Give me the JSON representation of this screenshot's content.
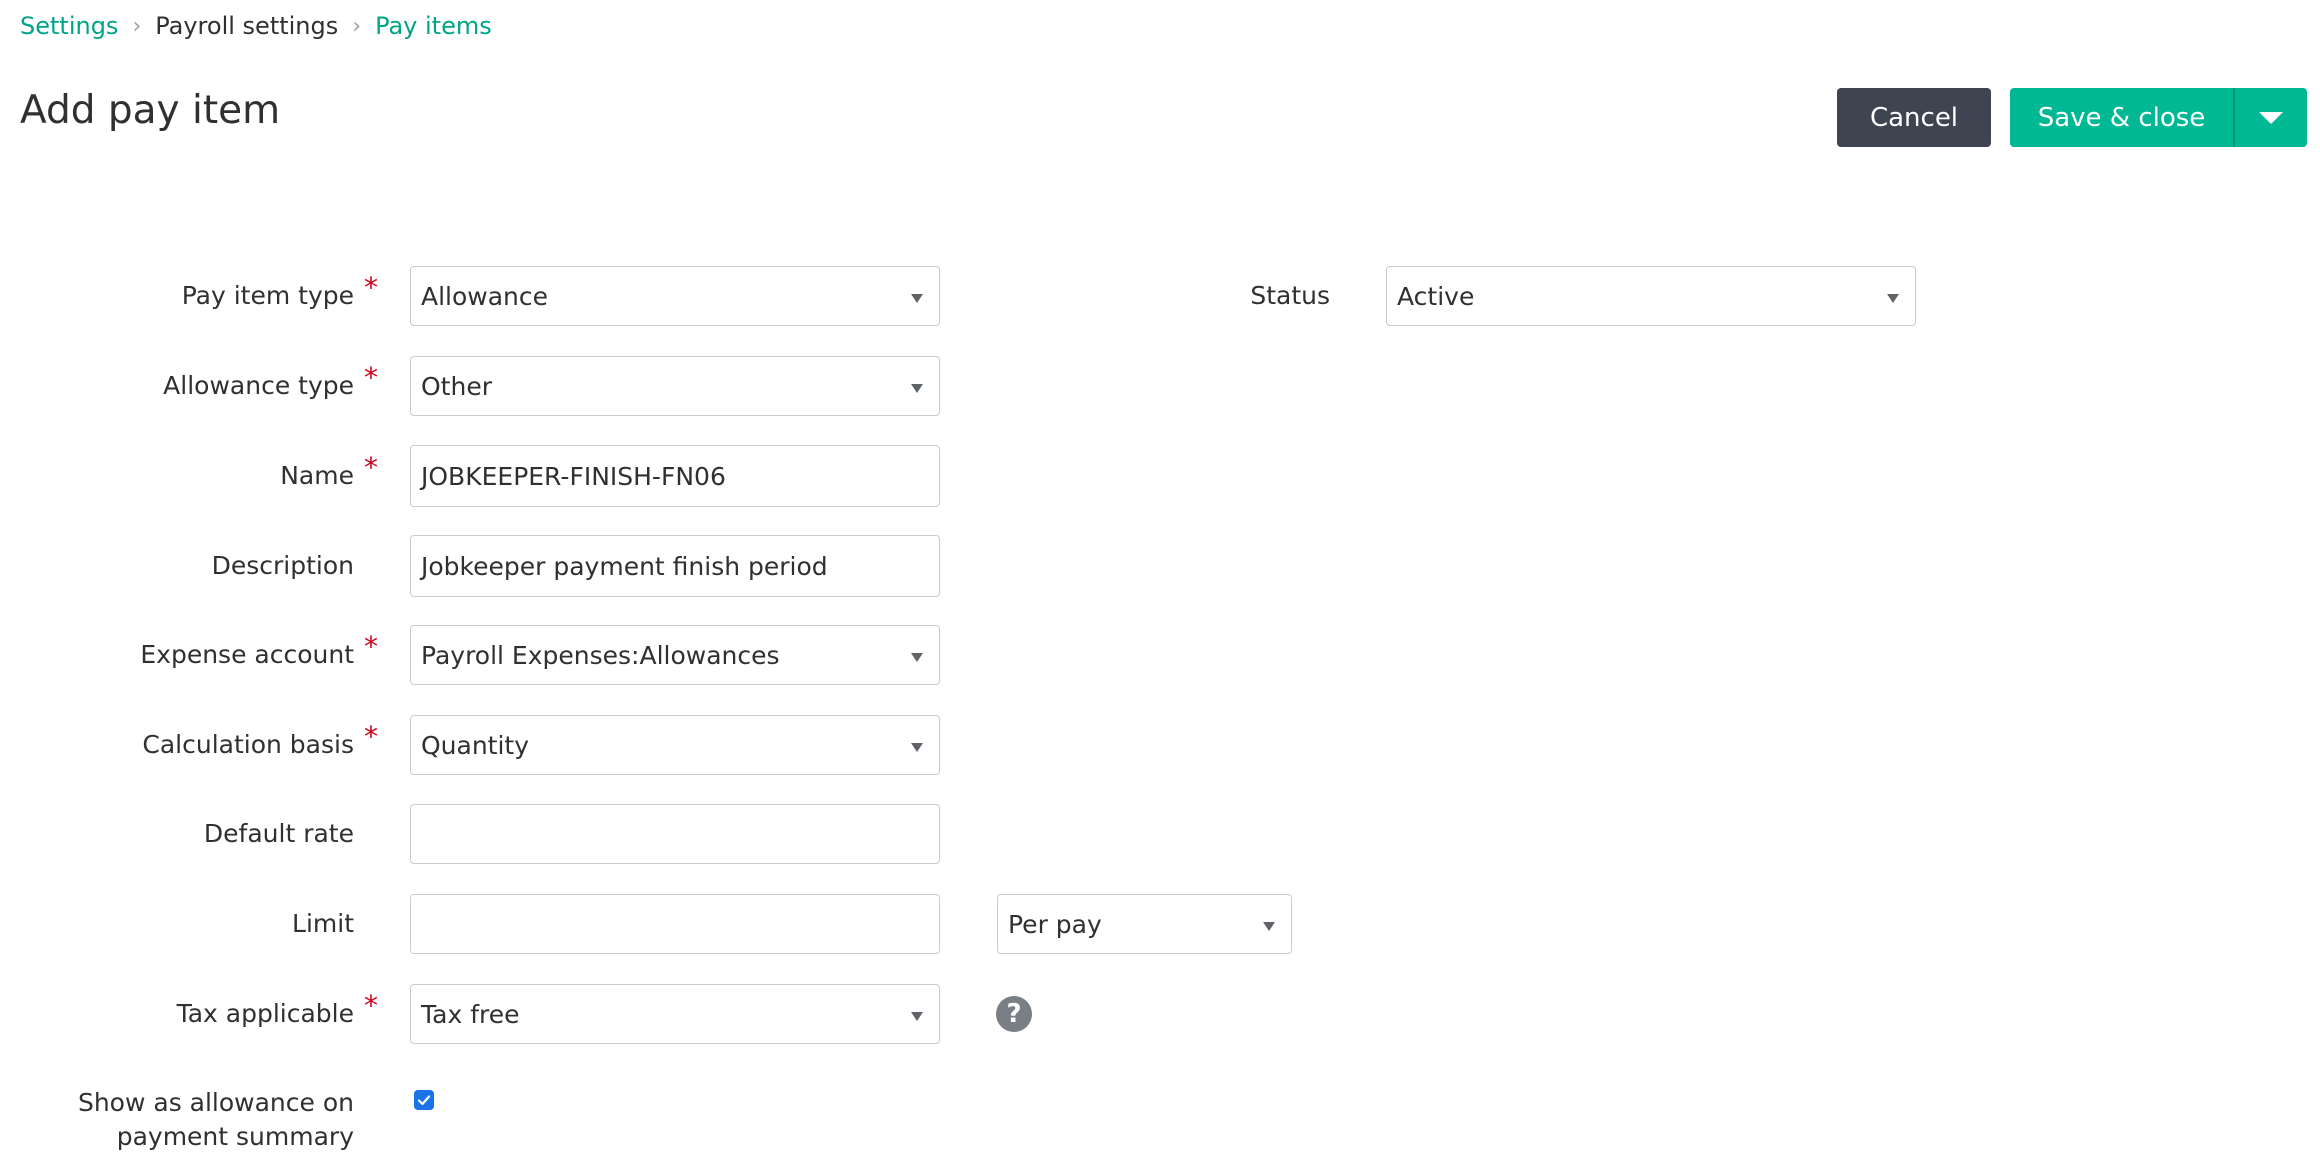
{
  "breadcrumb": {
    "items": [
      {
        "label": "Settings"
      },
      {
        "label": "Payroll settings"
      },
      {
        "label": "Pay items"
      }
    ]
  },
  "header": {
    "title": "Add pay item",
    "cancel_label": "Cancel",
    "save_label": "Save & close"
  },
  "form": {
    "pay_item_type": {
      "label": "Pay item type",
      "value": "Allowance",
      "required": "*"
    },
    "status": {
      "label": "Status",
      "value": "Active"
    },
    "allowance_type": {
      "label": "Allowance type",
      "value": "Other",
      "required": "*"
    },
    "name": {
      "label": "Name",
      "value": "JOBKEEPER-FINISH-FN06",
      "required": "*"
    },
    "description": {
      "label": "Description",
      "value": "Jobkeeper payment finish period"
    },
    "expense_account": {
      "label": "Expense account",
      "value": "Payroll Expenses:Allowances",
      "required": "*"
    },
    "calculation_basis": {
      "label": "Calculation basis",
      "value": "Quantity",
      "required": "*"
    },
    "default_rate": {
      "label": "Default rate",
      "value": ""
    },
    "limit": {
      "label": "Limit",
      "value": "",
      "period_value": "Per pay"
    },
    "tax_applicable": {
      "label": "Tax applicable",
      "value": "Tax free",
      "required": "*",
      "help_glyph": "?"
    },
    "show_allowance": {
      "label_line1": "Show as allowance on",
      "label_line2": "payment summary",
      "checked": true
    }
  },
  "colors": {
    "accent": "#00b894",
    "link": "#00a587",
    "dark_button": "#3e4551",
    "required": "#d0021b",
    "checkbox": "#1a73e8"
  },
  "icons": {
    "breadcrumb_separator": "chevron-right-icon",
    "select_arrow": "caret-down-icon",
    "help": "question-circle-icon",
    "split_button": "caret-down-icon",
    "checkbox": "checkmark-icon"
  }
}
